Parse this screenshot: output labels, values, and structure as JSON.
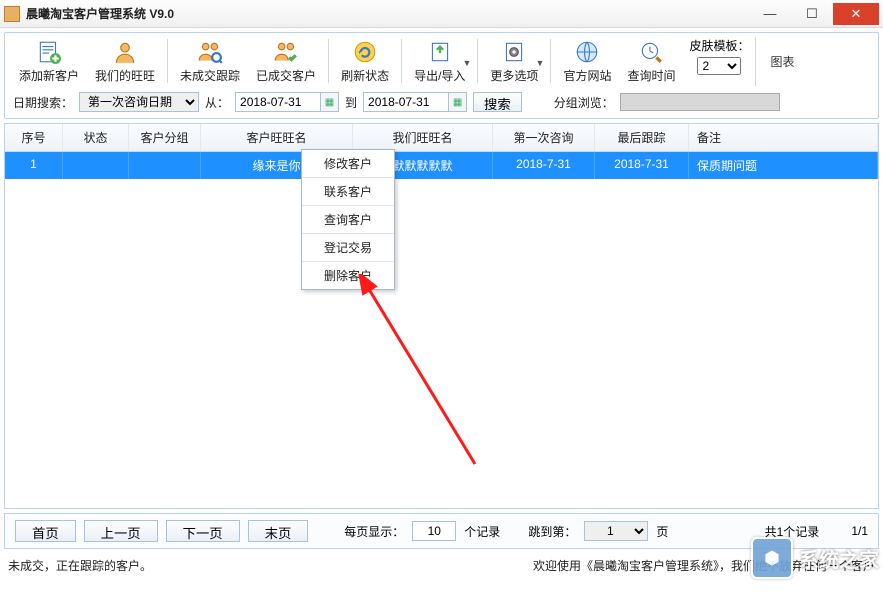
{
  "window": {
    "title": "晨曦淘宝客户管理系统 V9.0"
  },
  "toolbar": {
    "add_customer": "添加新客户",
    "my_wangwang": "我们的旺旺",
    "not_traded_track": "未成交跟踪",
    "traded_customer": "已成交客户",
    "refresh_status": "刷新状态",
    "export_import": "导出/导入",
    "more_options": "更多选项",
    "official_site": "官方网站",
    "query_time": "查询时间",
    "skin_label": "皮肤模板：",
    "skin_value": "2",
    "chart": "图表"
  },
  "search": {
    "date_search_label": "日期搜索：",
    "date_type": "第一次咨询日期",
    "from_label": "从：",
    "from_date": "2018-07-31",
    "to_label": "到",
    "to_date": "2018-07-31",
    "search_btn": "搜索",
    "group_browse_label": "分组浏览："
  },
  "table": {
    "headers": {
      "seq": "序号",
      "status": "状态",
      "group": "客户分组",
      "cust_ww": "客户旺旺名",
      "our_ww": "我们旺旺名",
      "first": "第一次咨询",
      "last": "最后跟踪",
      "note": "备注"
    },
    "rows": [
      {
        "seq": "1",
        "status": "",
        "group": "",
        "cust_ww": "缘来是你",
        "our_ww": "默默默默默",
        "first": "2018-7-31",
        "last": "2018-7-31",
        "note": "保质期问题"
      }
    ]
  },
  "context_menu": {
    "items": [
      "修改客户",
      "联系客户",
      "查询客户",
      "登记交易",
      "删除客户"
    ]
  },
  "pager": {
    "first": "首页",
    "prev": "上一页",
    "next": "下一页",
    "last": "末页",
    "per_page_label": "每页显示：",
    "per_page_value": "10",
    "records_label": "个记录",
    "jump_label": "跳到第：",
    "jump_value": "1",
    "page_unit": "页",
    "total_records": "共1个记录",
    "page_pos": "1/1"
  },
  "status": {
    "left": "未成交，正在跟踪的客户。",
    "right": "欢迎使用《晨曦淘宝客户管理系统》，我们绝不放弃任何一个客户"
  },
  "watermark": {
    "text": "系统之家"
  }
}
